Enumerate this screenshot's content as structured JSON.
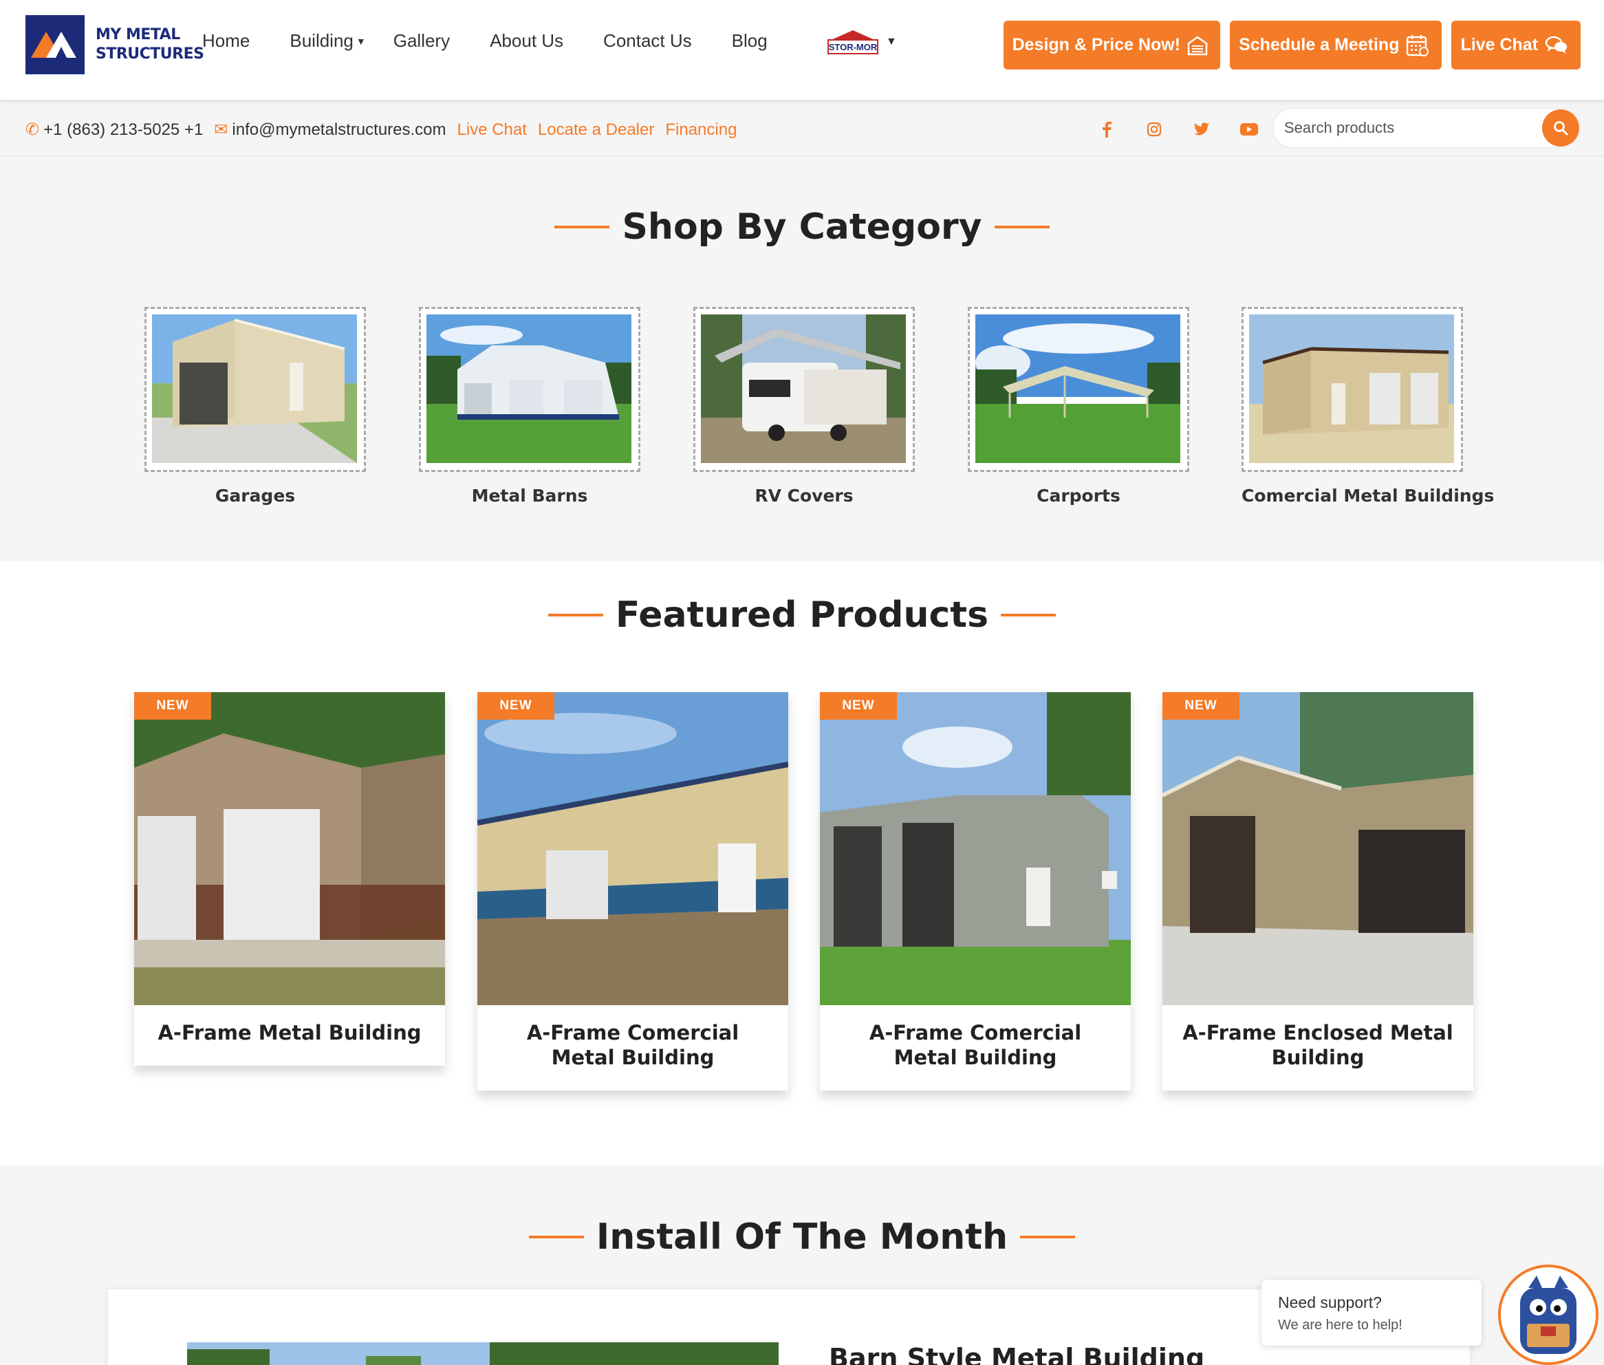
{
  "brand": {
    "logo_line1": "MY METAL",
    "logo_line2": "STRUCTURES",
    "accent": "#f47b27",
    "navy": "#1c2a78"
  },
  "nav": {
    "items": [
      {
        "label": "Home"
      },
      {
        "label": "Building"
      },
      {
        "label": "Gallery"
      },
      {
        "label": "About Us"
      },
      {
        "label": "Contact Us"
      },
      {
        "label": "Blog"
      }
    ],
    "partner_logo": "STOR-MOR"
  },
  "cta": {
    "design": "Design & Price Now!",
    "schedule": "Schedule a Meeting",
    "chat": "Live Chat"
  },
  "topbar": {
    "phone": "+1 (863) 213-5025 +1",
    "email": "info@mymetalstructures.com",
    "links": [
      "Live Chat",
      "Locate a Dealer",
      "Financing"
    ],
    "social_icons": [
      "facebook-icon",
      "instagram-icon",
      "twitter-icon",
      "youtube-icon"
    ],
    "search_placeholder": "Search products"
  },
  "categories": {
    "title": "Shop By Category",
    "items": [
      {
        "label": "Garages"
      },
      {
        "label": "Metal Barns"
      },
      {
        "label": "RV Covers"
      },
      {
        "label": "Carports"
      },
      {
        "label": "Comercial Metal Buildings"
      }
    ]
  },
  "featured": {
    "title": "Featured Products",
    "badge": "NEW",
    "products": [
      {
        "title": "A-Frame Metal Building"
      },
      {
        "title": "A-Frame Comercial Metal Building"
      },
      {
        "title": "A-Frame Comercial Metal Building"
      },
      {
        "title": "A-Frame Enclosed Metal Building"
      }
    ]
  },
  "install": {
    "title": "Install Of The Month",
    "item_title": "Barn Style Metal Building"
  },
  "support": {
    "title": "Need support?",
    "subtitle": "We are here to help!"
  }
}
